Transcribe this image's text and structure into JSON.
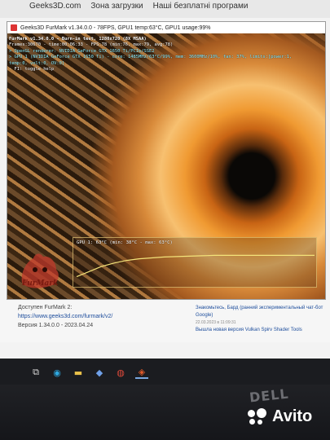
{
  "web": {
    "nav": [
      "Geeks3D.com",
      "Зона загрузки",
      "Наші безплатні програми"
    ],
    "left_text": "Доступен FurMark 2:",
    "left_link": "https://www.geeks3d.com/furmark/v2/",
    "left_text2": "Версия 1.34.0.0 - 2023.04.24",
    "right_link": "Знакомьтесь, Бард (ранний экспериментальный чат-бот Google)",
    "right_date": "22.03.2023 в 11:09:31",
    "right_link2": "Вышла новая версия Vulkan Spirv Shader Tools"
  },
  "furmark": {
    "title": "Geeks3D FurMark v1.34.0.0 - 78FPS, GPU1 temp:63°C, GPU1 usage:99%",
    "lines": [
      "FurMark v1.34.0.0 - Burn-in test, 1280x720 (8X MSAA)",
      "Frames:30670 - time:00:06:33 - FPS:78 (min:76, max:79, avg:78)",
      "> OpenGL renderer: NVIDIA GeForce GTX 1650 Ti/PCIe/SSE2",
      "> GPU 1 (NVIDIA GeForce GTX 1650 Ti) - core: 1485MHz/63°C/99%, mem: 3600MHz/10%, fan: 37%, limits:[power:1, temp:0, volt:0, OV:0]",
      "- F1: toggle help"
    ],
    "temp_label": "GPU 1: 63°C (min: 38°C - max: 63°C)",
    "logo_text": "FurMark",
    "temp_series": [
      38,
      44,
      50,
      54,
      57,
      59,
      60,
      61,
      61.5,
      62,
      62.5,
      63,
      63,
      63,
      63,
      63,
      63,
      63,
      63,
      63
    ]
  },
  "taskbar": {
    "items": [
      {
        "name": "task-view-icon",
        "glyph": "⧉"
      },
      {
        "name": "edge-icon",
        "glyph": "◉",
        "color": "#2ea8e0"
      },
      {
        "name": "file-explorer-icon",
        "glyph": "▬",
        "color": "#e8c04a"
      },
      {
        "name": "app-icon",
        "glyph": "◆",
        "color": "#6fa0e8"
      },
      {
        "name": "chrome-icon",
        "glyph": "◍",
        "color": "#e04a3a"
      },
      {
        "name": "furmark-taskbar-icon",
        "glyph": "◈",
        "color": "#e05a2a"
      }
    ]
  },
  "bezel": {
    "brand": "DELL"
  },
  "watermark": {
    "text": "Avito"
  }
}
